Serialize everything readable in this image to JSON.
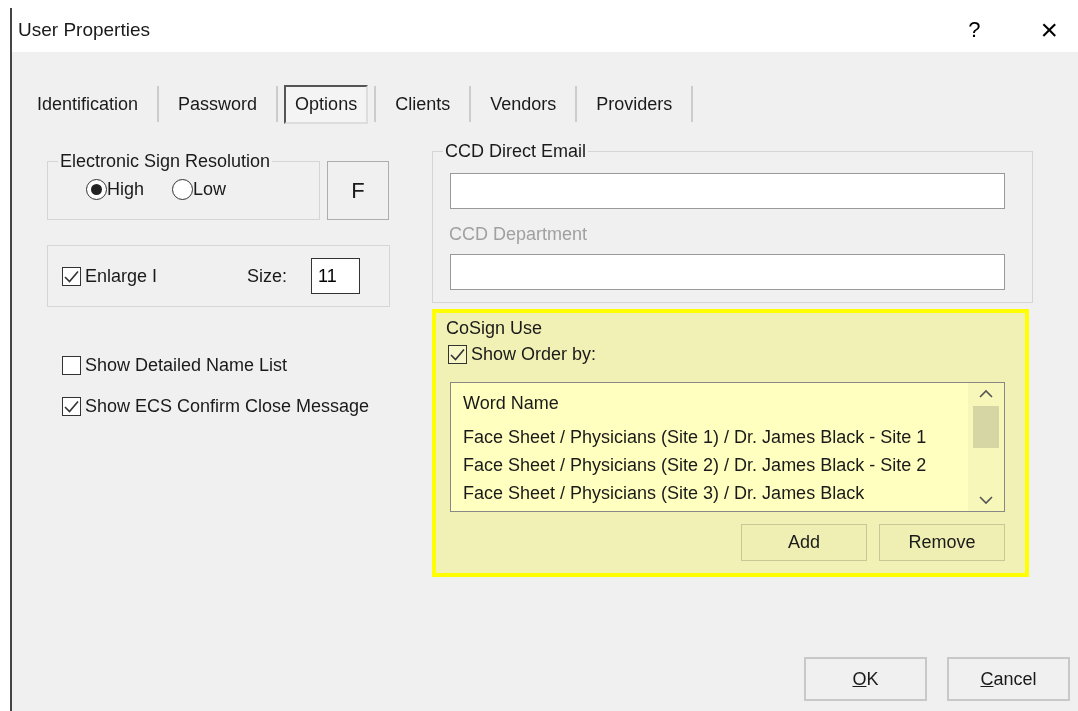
{
  "window": {
    "title": "User Properties",
    "help_button": "?",
    "close_button": "×"
  },
  "tabs": [
    {
      "label": "Identification",
      "selected": false
    },
    {
      "label": "Password",
      "selected": false
    },
    {
      "label": "Options",
      "selected": true
    },
    {
      "label": "Clients",
      "selected": false
    },
    {
      "label": "Vendors",
      "selected": false
    },
    {
      "label": "Providers",
      "selected": false
    }
  ],
  "sign_resolution": {
    "title": "Electronic Sign Resolution",
    "options": [
      {
        "label": "High",
        "selected": true
      },
      {
        "label": "Low",
        "selected": false
      }
    ],
    "font_button": "F"
  },
  "enlarge": {
    "label": "Enlarge I",
    "checked": true,
    "size_label": "Size:",
    "size_value": "11"
  },
  "options": [
    {
      "label": "Show Detailed Name List",
      "checked": false
    },
    {
      "label": "Show ECS Confirm Close Message",
      "checked": true
    }
  ],
  "ccd": {
    "email_label": "CCD Direct Email",
    "email_disabled": false,
    "department_label": "CCD Department",
    "department_disabled": true
  },
  "cosign": {
    "title": "CoSign Use",
    "highlighted": true,
    "show_order": {
      "label": "Show Order by:",
      "checked": true
    },
    "list": {
      "column": "Word Name",
      "rows": [
        "Face Sheet / Physicians (Site 1) / Dr. James Black - Site 1",
        "Face Sheet / Physicians (Site 2) / Dr. James Black - Site 2",
        "Face Sheet / Physicians (Site 3) / Dr. James Black"
      ]
    },
    "buttons": [
      "Add",
      "Remove"
    ]
  },
  "buttons": [
    {
      "label": "OK",
      "first_letter_underlined": true
    },
    {
      "label": "Cancel",
      "first_letter_underlined": true
    }
  ]
}
